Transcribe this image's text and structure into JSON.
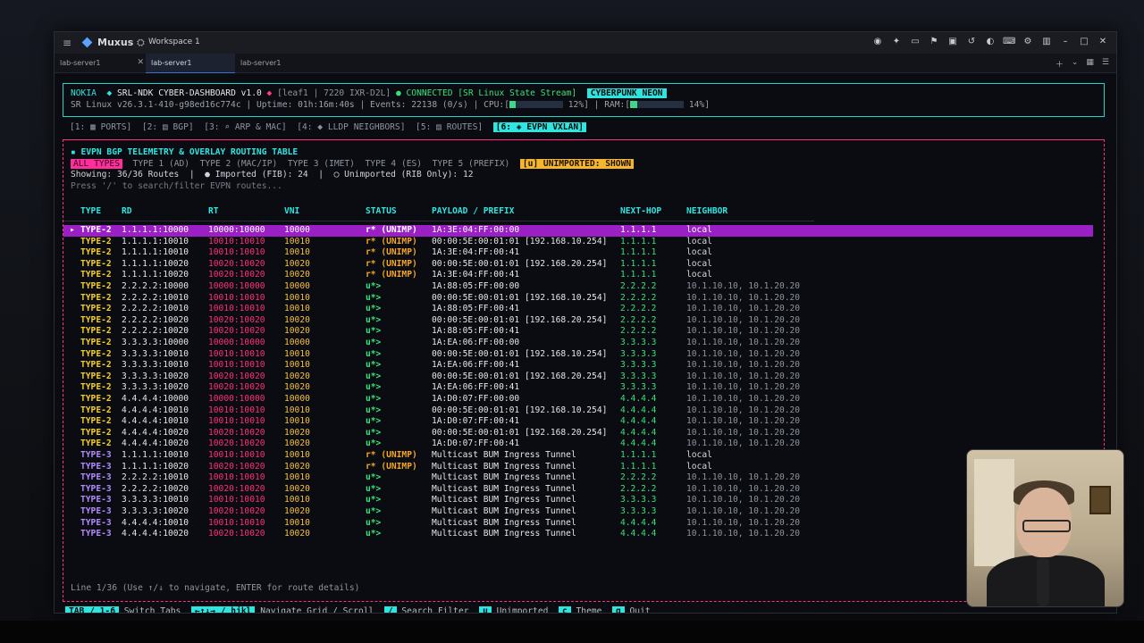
{
  "window": {
    "app_name": "Muxus",
    "workspace": "Workspace 1",
    "tabs": [
      {
        "label": "lab-server1",
        "active": false,
        "closable": true
      },
      {
        "label": "lab-server1",
        "active": true,
        "closable": false
      },
      {
        "label": "lab-server1",
        "active": false,
        "closable": false
      }
    ]
  },
  "header": {
    "brand": "NOKIA",
    "dashboard": "SRL-NDK CYBER-DASHBOARD v1.0",
    "node": "[leaf1 | 7220 IXR-D2L]",
    "connection": "CONNECTED [SR Linux State Stream]",
    "theme_badge": "CYBERPUNK NEON",
    "version": "SR Linux v26.3.1-410-g98ed16c774c",
    "uptime": "Uptime: 01h:16m:40s",
    "events": "Events: 22138 (0/s)",
    "cpu_label": "CPU:[",
    "cpu_pct": "12%]",
    "cpu_value": 12,
    "ram_label": "RAM:[",
    "ram_pct": "14%]",
    "ram_value": 14
  },
  "nav_tabs": [
    "[1: ▦ PORTS]",
    "[2: ▤ BGP]",
    "[3: ⌕ ARP & MAC]",
    "[4: ◆ LLDP NEIGHBORS]",
    "[5: ▤ ROUTES]",
    "[6: ◈ EVPN VXLAN]"
  ],
  "panel": {
    "title": "▪ EVPN BGP TELEMETRY & OVERLAY ROUTING TABLE",
    "filters": [
      "ALL TYPES",
      "TYPE 1 (AD)",
      "TYPE 2 (MAC/IP)",
      "TYPE 3 (IMET)",
      "TYPE 4 (ES)",
      "TYPE 5 (PREFIX)"
    ],
    "unimported_toggle": "[u] UNIMPORTED: SHOWN",
    "stats": "Showing: 36/36 Routes  |  ● Imported (FIB): 24  |  ◯ Unimported (RIB Only): 12",
    "search_hint": "Press '/' to search/filter EVPN routes...",
    "columns": [
      "TYPE",
      "RD",
      "RT",
      "VNI",
      "STATUS",
      "PAYLOAD / PREFIX",
      "NEXT-HOP",
      "NEIGHBOR"
    ],
    "line_info": "Line 1/36 (Use ↑/↓ to navigate, ENTER for route details)"
  },
  "routes": [
    {
      "type": "TYPE-2",
      "rd": "1.1.1.1:10000",
      "rt": "10000:10000",
      "vni": "10000",
      "status": "r* (UNIMP)",
      "payload": "1A:3E:04:FF:00:00",
      "nh": "1.1.1.1",
      "nb": "local"
    },
    {
      "type": "TYPE-2",
      "rd": "1.1.1.1:10010",
      "rt": "10010:10010",
      "vni": "10010",
      "status": "r* (UNIMP)",
      "payload": "00:00:5E:00:01:01 [192.168.10.254]",
      "nh": "1.1.1.1",
      "nb": "local"
    },
    {
      "type": "TYPE-2",
      "rd": "1.1.1.1:10010",
      "rt": "10010:10010",
      "vni": "10010",
      "status": "r* (UNIMP)",
      "payload": "1A:3E:04:FF:00:41",
      "nh": "1.1.1.1",
      "nb": "local"
    },
    {
      "type": "TYPE-2",
      "rd": "1.1.1.1:10020",
      "rt": "10020:10020",
      "vni": "10020",
      "status": "r* (UNIMP)",
      "payload": "00:00:5E:00:01:01 [192.168.20.254]",
      "nh": "1.1.1.1",
      "nb": "local"
    },
    {
      "type": "TYPE-2",
      "rd": "1.1.1.1:10020",
      "rt": "10020:10020",
      "vni": "10020",
      "status": "r* (UNIMP)",
      "payload": "1A:3E:04:FF:00:41",
      "nh": "1.1.1.1",
      "nb": "local"
    },
    {
      "type": "TYPE-2",
      "rd": "2.2.2.2:10000",
      "rt": "10000:10000",
      "vni": "10000",
      "status": "u*>",
      "payload": "1A:88:05:FF:00:00",
      "nh": "2.2.2.2",
      "nb": "10.1.10.10, 10.1.20.20"
    },
    {
      "type": "TYPE-2",
      "rd": "2.2.2.2:10010",
      "rt": "10010:10010",
      "vni": "10010",
      "status": "u*>",
      "payload": "00:00:5E:00:01:01 [192.168.10.254]",
      "nh": "2.2.2.2",
      "nb": "10.1.10.10, 10.1.20.20"
    },
    {
      "type": "TYPE-2",
      "rd": "2.2.2.2:10010",
      "rt": "10010:10010",
      "vni": "10010",
      "status": "u*>",
      "payload": "1A:88:05:FF:00:41",
      "nh": "2.2.2.2",
      "nb": "10.1.10.10, 10.1.20.20"
    },
    {
      "type": "TYPE-2",
      "rd": "2.2.2.2:10020",
      "rt": "10020:10020",
      "vni": "10020",
      "status": "u*>",
      "payload": "00:00:5E:00:01:01 [192.168.20.254]",
      "nh": "2.2.2.2",
      "nb": "10.1.10.10, 10.1.20.20"
    },
    {
      "type": "TYPE-2",
      "rd": "2.2.2.2:10020",
      "rt": "10020:10020",
      "vni": "10020",
      "status": "u*>",
      "payload": "1A:88:05:FF:00:41",
      "nh": "2.2.2.2",
      "nb": "10.1.10.10, 10.1.20.20"
    },
    {
      "type": "TYPE-2",
      "rd": "3.3.3.3:10000",
      "rt": "10000:10000",
      "vni": "10000",
      "status": "u*>",
      "payload": "1A:EA:06:FF:00:00",
      "nh": "3.3.3.3",
      "nb": "10.1.10.10, 10.1.20.20"
    },
    {
      "type": "TYPE-2",
      "rd": "3.3.3.3:10010",
      "rt": "10010:10010",
      "vni": "10010",
      "status": "u*>",
      "payload": "00:00:5E:00:01:01 [192.168.10.254]",
      "nh": "3.3.3.3",
      "nb": "10.1.10.10, 10.1.20.20"
    },
    {
      "type": "TYPE-2",
      "rd": "3.3.3.3:10010",
      "rt": "10010:10010",
      "vni": "10010",
      "status": "u*>",
      "payload": "1A:EA:06:FF:00:41",
      "nh": "3.3.3.3",
      "nb": "10.1.10.10, 10.1.20.20"
    },
    {
      "type": "TYPE-2",
      "rd": "3.3.3.3:10020",
      "rt": "10020:10020",
      "vni": "10020",
      "status": "u*>",
      "payload": "00:00:5E:00:01:01 [192.168.20.254]",
      "nh": "3.3.3.3",
      "nb": "10.1.10.10, 10.1.20.20"
    },
    {
      "type": "TYPE-2",
      "rd": "3.3.3.3:10020",
      "rt": "10020:10020",
      "vni": "10020",
      "status": "u*>",
      "payload": "1A:EA:06:FF:00:41",
      "nh": "3.3.3.3",
      "nb": "10.1.10.10, 10.1.20.20"
    },
    {
      "type": "TYPE-2",
      "rd": "4.4.4.4:10000",
      "rt": "10000:10000",
      "vni": "10000",
      "status": "u*>",
      "payload": "1A:D0:07:FF:00:00",
      "nh": "4.4.4.4",
      "nb": "10.1.10.10, 10.1.20.20"
    },
    {
      "type": "TYPE-2",
      "rd": "4.4.4.4:10010",
      "rt": "10010:10010",
      "vni": "10010",
      "status": "u*>",
      "payload": "00:00:5E:00:01:01 [192.168.10.254]",
      "nh": "4.4.4.4",
      "nb": "10.1.10.10, 10.1.20.20"
    },
    {
      "type": "TYPE-2",
      "rd": "4.4.4.4:10010",
      "rt": "10010:10010",
      "vni": "10010",
      "status": "u*>",
      "payload": "1A:D0:07:FF:00:41",
      "nh": "4.4.4.4",
      "nb": "10.1.10.10, 10.1.20.20"
    },
    {
      "type": "TYPE-2",
      "rd": "4.4.4.4:10020",
      "rt": "10020:10020",
      "vni": "10020",
      "status": "u*>",
      "payload": "00:00:5E:00:01:01 [192.168.20.254]",
      "nh": "4.4.4.4",
      "nb": "10.1.10.10, 10.1.20.20"
    },
    {
      "type": "TYPE-2",
      "rd": "4.4.4.4:10020",
      "rt": "10020:10020",
      "vni": "10020",
      "status": "u*>",
      "payload": "1A:D0:07:FF:00:41",
      "nh": "4.4.4.4",
      "nb": "10.1.10.10, 10.1.20.20"
    },
    {
      "type": "TYPE-3",
      "rd": "1.1.1.1:10010",
      "rt": "10010:10010",
      "vni": "10010",
      "status": "r* (UNIMP)",
      "payload": "Multicast BUM Ingress Tunnel",
      "nh": "1.1.1.1",
      "nb": "local"
    },
    {
      "type": "TYPE-3",
      "rd": "1.1.1.1:10020",
      "rt": "10020:10020",
      "vni": "10020",
      "status": "r* (UNIMP)",
      "payload": "Multicast BUM Ingress Tunnel",
      "nh": "1.1.1.1",
      "nb": "local"
    },
    {
      "type": "TYPE-3",
      "rd": "2.2.2.2:10010",
      "rt": "10010:10010",
      "vni": "10010",
      "status": "u*>",
      "payload": "Multicast BUM Ingress Tunnel",
      "nh": "2.2.2.2",
      "nb": "10.1.10.10, 10.1.20.20"
    },
    {
      "type": "TYPE-3",
      "rd": "2.2.2.2:10020",
      "rt": "10020:10020",
      "vni": "10020",
      "status": "u*>",
      "payload": "Multicast BUM Ingress Tunnel",
      "nh": "2.2.2.2",
      "nb": "10.1.10.10, 10.1.20.20"
    },
    {
      "type": "TYPE-3",
      "rd": "3.3.3.3:10010",
      "rt": "10010:10010",
      "vni": "10010",
      "status": "u*>",
      "payload": "Multicast BUM Ingress Tunnel",
      "nh": "3.3.3.3",
      "nb": "10.1.10.10, 10.1.20.20"
    },
    {
      "type": "TYPE-3",
      "rd": "3.3.3.3:10020",
      "rt": "10020:10020",
      "vni": "10020",
      "status": "u*>",
      "payload": "Multicast BUM Ingress Tunnel",
      "nh": "3.3.3.3",
      "nb": "10.1.10.10, 10.1.20.20"
    },
    {
      "type": "TYPE-3",
      "rd": "4.4.4.4:10010",
      "rt": "10010:10010",
      "vni": "10010",
      "status": "u*>",
      "payload": "Multicast BUM Ingress Tunnel",
      "nh": "4.4.4.4",
      "nb": "10.1.10.10, 10.1.20.20"
    },
    {
      "type": "TYPE-3",
      "rd": "4.4.4.4:10020",
      "rt": "10020:10020",
      "vni": "10020",
      "status": "u*>",
      "payload": "Multicast BUM Ingress Tunnel",
      "nh": "4.4.4.4",
      "nb": "10.1.10.10, 10.1.20.20"
    }
  ],
  "footer": [
    {
      "key": "TAB / 1-6",
      "label": "Switch Tabs"
    },
    {
      "key": "←↑↓→ / hjkl",
      "label": "Navigate Grid / Scroll"
    },
    {
      "key": "/",
      "label": "Search Filter"
    },
    {
      "key": "u",
      "label": "Unimported"
    },
    {
      "key": "c",
      "label": "Theme"
    },
    {
      "key": "q",
      "label": "Quit"
    }
  ],
  "colors": {
    "accent": "#2ee6e0",
    "border": "#ff2e7e",
    "selected_row": "#9a1fc4",
    "status_ok": "#39e07a",
    "status_unimp": "#f5a623"
  }
}
